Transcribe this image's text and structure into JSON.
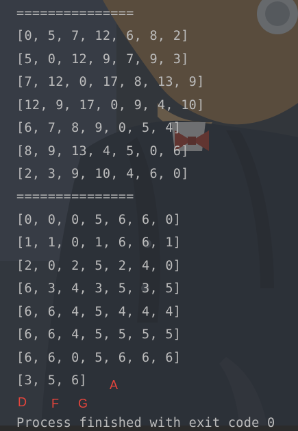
{
  "console": {
    "separator": "===============",
    "matrix_lines": [
      "[0, 5, 7, 12, 6, 8, 2]",
      "[5, 0, 12, 9, 7, 9, 3]",
      "[7, 12, 0, 17, 8, 13, 9]",
      "[12, 9, 17, 0, 9, 4, 10]",
      "[6, 7, 8, 9, 0, 5, 4]",
      "[8, 9, 13, 4, 5, 0, 6]",
      "[2, 3, 9, 10, 4, 6, 0]"
    ],
    "path_lines": [
      "[0, 0, 0, 5, 6, 6, 0]",
      "[1, 1, 0, 1, 6, 6, 1]",
      "[2, 0, 2, 5, 2, 4, 0]",
      "[6, 3, 4, 3, 5, 3, 5]",
      "[6, 6, 4, 5, 4, 4, 4]",
      "[6, 6, 4, 5, 5, 5, 5]",
      "[6, 6, 0, 5, 6, 6, 6]"
    ],
    "result_line": "[3, 5, 6]",
    "exit_message": "Process finished with exit code 0"
  },
  "annotations": {
    "a": "A",
    "d": "D",
    "f": "F",
    "g": "G"
  },
  "colors": {
    "text": "#bcbcbc",
    "annotation": "#e8453c",
    "background": "#2b2b2b"
  }
}
